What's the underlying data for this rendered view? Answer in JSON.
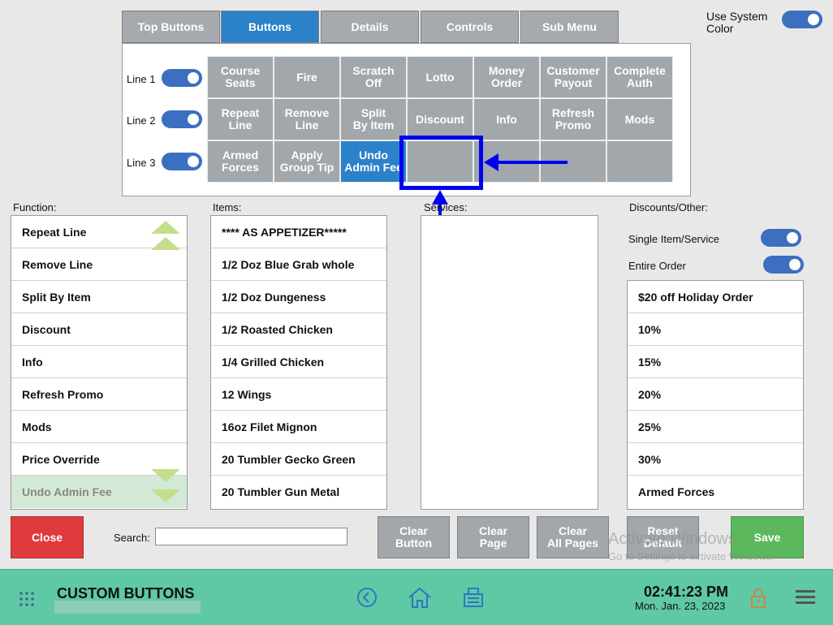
{
  "tabs": [
    {
      "label": "Top Buttons",
      "active": false
    },
    {
      "label": "Buttons",
      "active": true
    },
    {
      "label": "Details",
      "active": false
    },
    {
      "label": "Controls",
      "active": false
    },
    {
      "label": "Sub Menu",
      "active": false
    }
  ],
  "system_color": {
    "label": "Use System\nColor",
    "on": true
  },
  "lines": [
    {
      "label": "Line 1",
      "on": true
    },
    {
      "label": "Line 2",
      "on": true
    },
    {
      "label": "Line 3",
      "on": true
    }
  ],
  "button_grid": [
    [
      "Course\nSeats",
      "Fire",
      "Scratch\nOff",
      "Lotto",
      "Money\nOrder",
      "Customer\nPayout",
      "Complete\nAuth"
    ],
    [
      "Repeat\nLine",
      "Remove\nLine",
      "Split\nBy Item",
      "Discount",
      "Info",
      "Refresh\nPromo",
      "Mods"
    ],
    [
      "Armed\nForces",
      "Apply\nGroup Tip",
      "Undo\nAdmin Fee",
      "",
      "",
      "",
      ""
    ]
  ],
  "selected_grid_button": "Undo\nAdmin Fee",
  "sections": {
    "function": "Function:",
    "items": "Items:",
    "services": "Services:",
    "discounts": "Discounts/Other:"
  },
  "function_list": [
    "Repeat Line",
    "Remove Line",
    "Split By Item",
    "Discount",
    "Info",
    "Refresh Promo",
    "Mods",
    "Price Override",
    "Undo Admin Fee"
  ],
  "function_selected": "Undo Admin Fee",
  "items_list": [
    "**** AS APPETIZER*****",
    "1/2 Doz Blue Grab whole",
    "1/2 Doz Dungeness",
    "1/2 Roasted Chicken",
    "1/4 Grilled Chicken",
    "12 Wings",
    "16oz Filet Mignon",
    "20 Tumbler Gecko Green",
    "20 Tumbler Gun Metal"
  ],
  "discount_options": [
    {
      "label": "Single Item/Service",
      "on": true
    },
    {
      "label": "Entire Order",
      "on": true
    }
  ],
  "discounts_list": [
    "$20 off Holiday Order",
    "10%",
    "15%",
    "20%",
    "25%",
    "30%",
    "Armed Forces"
  ],
  "close_label": "Close",
  "search": {
    "label": "Search:",
    "value": "",
    "placeholder": ""
  },
  "actions": {
    "clear_button": "Clear\nButton",
    "clear_page": "Clear\nPage",
    "clear_all_pages": "Clear\nAll Pages",
    "reset_default": "Reset\nDefault",
    "save": "Save"
  },
  "watermark": {
    "line1": "Activate Windows",
    "line2": "Go to Settings to activate Windows."
  },
  "footer": {
    "title": "CUSTOM BUTTONS",
    "time": "02:41:23 PM",
    "date": "Mon. Jan. 23, 2023"
  },
  "colors": {
    "accent_blue": "#2b82c9",
    "toggle_blue": "#3c6fbf",
    "close_red": "#e03a3c",
    "save_green": "#5cb85c",
    "footer_teal": "#5fc8a4",
    "annotation_blue": "#0000ee"
  },
  "icons": [
    "grid-menu-icon",
    "back-icon",
    "home-icon",
    "register-icon",
    "lock-icon",
    "hamburger-menu-icon"
  ]
}
